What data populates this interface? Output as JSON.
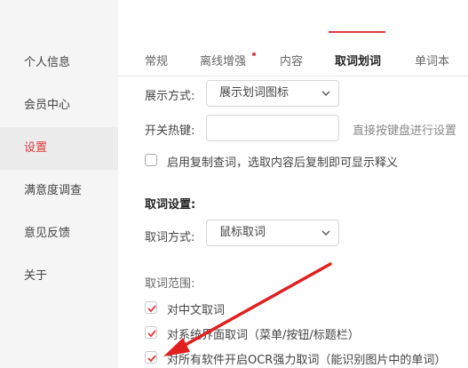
{
  "sidebar": {
    "items": [
      {
        "label": "个人信息"
      },
      {
        "label": "会员中心"
      },
      {
        "label": "设置"
      },
      {
        "label": "满意度调查"
      },
      {
        "label": "意见反馈"
      },
      {
        "label": "关于"
      }
    ],
    "active_index": 2
  },
  "tabs": [
    {
      "label": "常规"
    },
    {
      "label": "离线增强"
    },
    {
      "label": "内容"
    },
    {
      "label": "取词划词"
    },
    {
      "label": "单词本"
    }
  ],
  "display": {
    "mode_label": "展示方式:",
    "mode_value": "展示划词图标",
    "hotkey_label": "开关热键:",
    "hotkey_value": "",
    "hotkey_hint": "直接按键盘进行设置",
    "copy_lookup_text": "启用复制查词，选取内容后复制即可显示释义",
    "copy_lookup_checked": false
  },
  "lookup": {
    "section_title": "取词设置:",
    "method_label": "取词方式:",
    "method_value": "鼠标取词",
    "range_label": "取词范围:",
    "options": [
      {
        "text": "对中文取词",
        "checked": true
      },
      {
        "text": "对系统界面取词（菜单/按钮/标题栏）",
        "checked": true
      },
      {
        "text": "对所有软件开启OCR强力取词（能识别图片中的单词）",
        "checked": true
      }
    ]
  },
  "colors": {
    "accent": "#e0393e",
    "annotation_arrow": "#e02020"
  },
  "icons": {
    "select_chevron": "chevron-down-icon",
    "checkbox_mark": "checkmark-icon"
  }
}
